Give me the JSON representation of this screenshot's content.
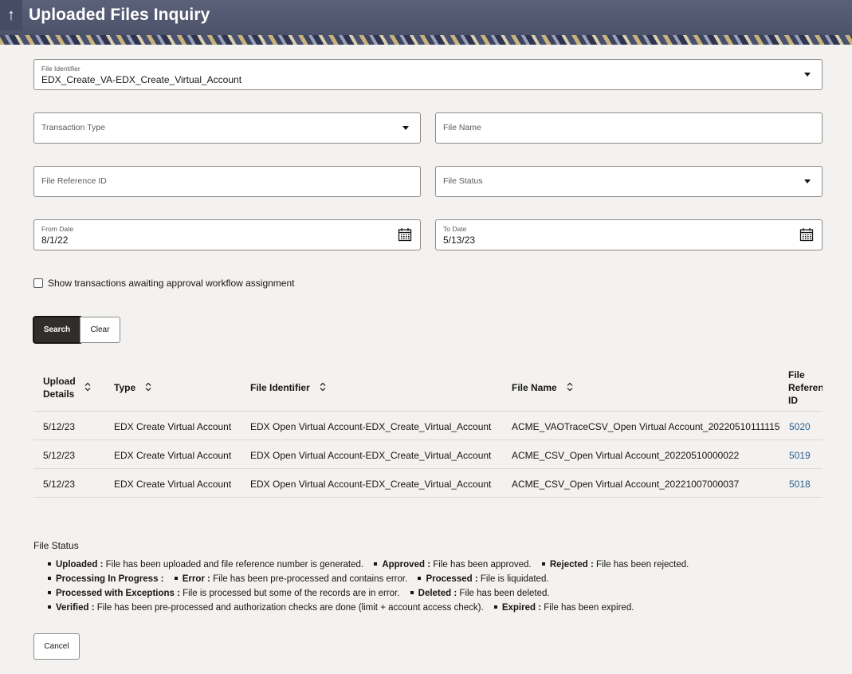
{
  "header": {
    "up_icon": "arrow-up-icon",
    "title": "Uploaded Files Inquiry"
  },
  "form": {
    "file_identifier": {
      "label": "File Identifier",
      "value": "EDX_Create_VA-EDX_Create_Virtual_Account"
    },
    "transaction_type": {
      "placeholder": "Transaction Type"
    },
    "file_name": {
      "placeholder": "File Name"
    },
    "file_reference_id": {
      "placeholder": "File Reference ID"
    },
    "file_status": {
      "placeholder": "File Status"
    },
    "from_date": {
      "label": "From Date",
      "value": "8/1/22"
    },
    "to_date": {
      "label": "To Date",
      "value": "5/13/23"
    },
    "approval_checkbox_label": "Show transactions awaiting approval workflow assignment",
    "approval_checked": false
  },
  "buttons": {
    "search": "Search",
    "clear": "Clear",
    "cancel": "Cancel"
  },
  "table": {
    "headers": {
      "upload_details_1": "Upload",
      "upload_details_2": "Details",
      "type": "Type",
      "file_identifier": "File Identifier",
      "file_name": "File Name",
      "file_ref_1": "File",
      "file_ref_2": "Referen",
      "file_ref_3": "ID"
    },
    "rows": [
      {
        "date": "5/12/23",
        "type": "EDX Create Virtual Account",
        "identifier": "EDX Open Virtual Account-EDX_Create_Virtual_Account",
        "file_name": "ACME_VAOTraceCSV_Open Virtual Account_20220510111115",
        "ref": "5020"
      },
      {
        "date": "5/12/23",
        "type": "EDX Create Virtual Account",
        "identifier": "EDX Open Virtual Account-EDX_Create_Virtual_Account",
        "file_name": "ACME_CSV_Open Virtual Account_20220510000022",
        "ref": "5019"
      },
      {
        "date": "5/12/23",
        "type": "EDX Create Virtual Account",
        "identifier": "EDX Open Virtual Account-EDX_Create_Virtual_Account",
        "file_name": "ACME_CSV_Open Virtual Account_20221007000037",
        "ref": "5018"
      }
    ]
  },
  "legend": {
    "title": "File Status",
    "items": [
      {
        "term": "Uploaded :",
        "desc": "File has been uploaded and file reference number is generated."
      },
      {
        "term": "Approved :",
        "desc": "File has been approved."
      },
      {
        "term": "Rejected :",
        "desc": "File has been rejected."
      },
      {
        "term": "Processing In Progress :",
        "desc": ""
      },
      {
        "term": "Error :",
        "desc": "File has been pre-processed and contains error."
      },
      {
        "term": "Processed :",
        "desc": "File is liquidated."
      },
      {
        "term": "Processed with Exceptions :",
        "desc": "File is processed but some of the records are in error."
      },
      {
        "term": "Deleted :",
        "desc": "File has been deleted."
      },
      {
        "term": "Verified :",
        "desc": "File has been pre-processed and authorization checks are done (limit + account access check)."
      },
      {
        "term": "Expired :",
        "desc": "File has been expired."
      }
    ]
  },
  "colors": {
    "header_bg": "#4f5670",
    "primary_button": "#312d2a",
    "link": "#2c5c8f",
    "page_bg": "#f3f2f0"
  }
}
